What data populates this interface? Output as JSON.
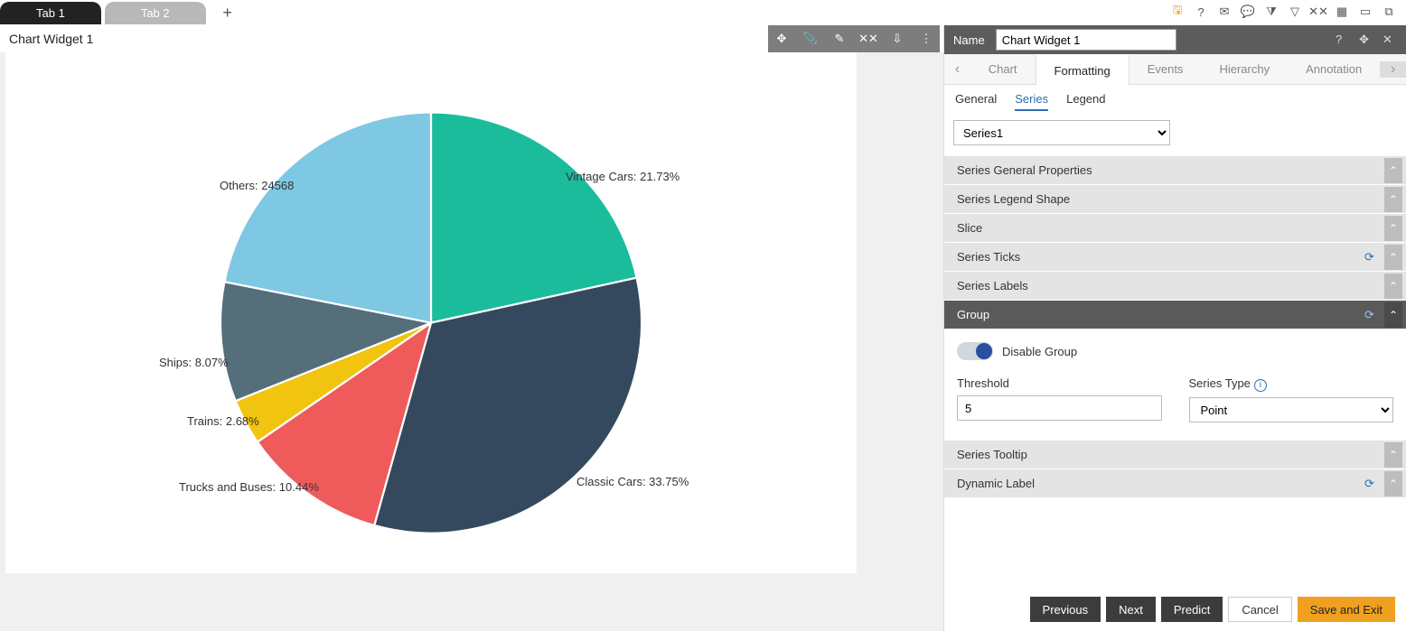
{
  "tabs": {
    "tab1": "Tab 1",
    "tab2": "Tab 2"
  },
  "widget": {
    "title": "Chart Widget 1"
  },
  "panel": {
    "name_label": "Name",
    "name_value": "Chart Widget 1",
    "tabs": {
      "chart": "Chart",
      "formatting": "Formatting",
      "events": "Events",
      "hierarchy": "Hierarchy",
      "annotation": "Annotation"
    },
    "subtabs": {
      "general": "General",
      "series": "Series",
      "legend": "Legend"
    },
    "series_selected": "Series1",
    "acc": {
      "sgp": "Series General Properties",
      "sls": "Series Legend Shape",
      "slice": "Slice",
      "sticks": "Series Ticks",
      "slabels": "Series Labels",
      "group": "Group",
      "stooltip": "Series Tooltip",
      "dlabel": "Dynamic Label"
    },
    "group_body": {
      "disable_group": "Disable Group",
      "threshold_label": "Threshold",
      "threshold_value": "5",
      "series_type_label": "Series Type",
      "series_type_value": "Point"
    },
    "footer": {
      "previous": "Previous",
      "next": "Next",
      "predict": "Predict",
      "cancel": "Cancel",
      "save": "Save and Exit"
    }
  },
  "chart_data": {
    "type": "pie",
    "title": "",
    "categories": [
      "Vintage Cars",
      "Classic Cars",
      "Trucks and Buses",
      "Trains",
      "Ships",
      "Others"
    ],
    "values_pct": [
      21.73,
      33.75,
      10.44,
      2.68,
      8.07,
      23.33
    ],
    "labels": [
      "Vintage Cars: 21.73%",
      "Classic Cars: 33.75%",
      "Trucks and Buses: 10.44%",
      "Trains: 2.68%",
      "Ships: 8.07%",
      "Others: 24568"
    ],
    "colors": [
      "#1abc9c",
      "#34495e",
      "#ef5b5b",
      "#f1c40f",
      "#546e7a",
      "#7ec8e3"
    ],
    "others_raw": 24568
  }
}
